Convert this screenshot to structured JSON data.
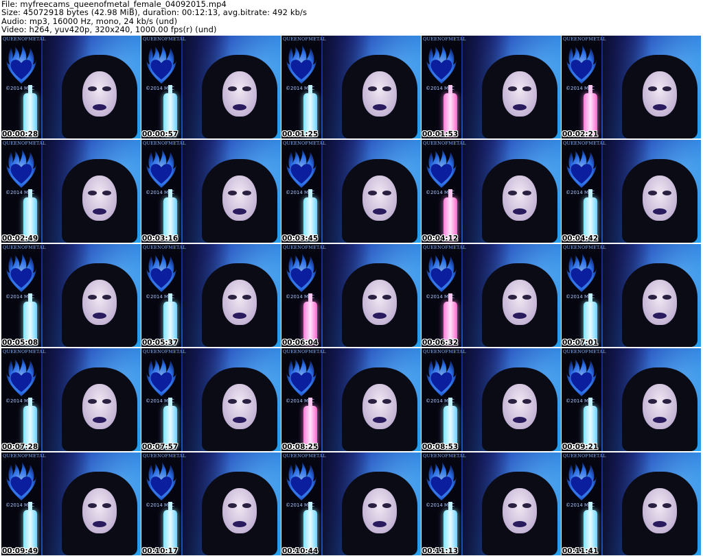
{
  "header": {
    "file_line": "File: myfreecams_queenofmetal_female_04092015.mp4",
    "size_line": "Size: 45072918 bytes (42.98 MiB), duration: 00:12:13, avg.bitrate: 492 kb/s",
    "audio_line": "Audio: mp3, 16000 Hz, mono, 24 kb/s (und)",
    "video_line": "Video: h264, yuv420p, 320x240, 1000.00 fps(r) (und)"
  },
  "overlay": {
    "logo_text": "QUEENOFMETAL",
    "copyright": "©2014 MFC"
  },
  "accent_colors": {
    "background_blue": "#1e74d8",
    "bottle_cyan": "#7be6ff",
    "bottle_pink": "#ff7ad9",
    "heart_flame": "#2f7bff"
  },
  "thumbnails": [
    {
      "timestamp": "00:00:28",
      "bottle": "cyan"
    },
    {
      "timestamp": "00:00:57",
      "bottle": "cyan"
    },
    {
      "timestamp": "00:01:25",
      "bottle": "cyan"
    },
    {
      "timestamp": "00:01:53",
      "bottle": "pink"
    },
    {
      "timestamp": "00:02:21",
      "bottle": "pink"
    },
    {
      "timestamp": "00:02:49",
      "bottle": "cyan"
    },
    {
      "timestamp": "00:03:16",
      "bottle": "cyan"
    },
    {
      "timestamp": "00:03:45",
      "bottle": "cyan"
    },
    {
      "timestamp": "00:04:12",
      "bottle": "pink"
    },
    {
      "timestamp": "00:04:42",
      "bottle": "cyan"
    },
    {
      "timestamp": "00:05:08",
      "bottle": "cyan"
    },
    {
      "timestamp": "00:05:37",
      "bottle": "cyan"
    },
    {
      "timestamp": "00:06:04",
      "bottle": "pink"
    },
    {
      "timestamp": "00:06:32",
      "bottle": "pink"
    },
    {
      "timestamp": "00:07:01",
      "bottle": "cyan"
    },
    {
      "timestamp": "00:07:28",
      "bottle": "cyan"
    },
    {
      "timestamp": "00:07:57",
      "bottle": "cyan"
    },
    {
      "timestamp": "00:08:25",
      "bottle": "pink"
    },
    {
      "timestamp": "00:08:53",
      "bottle": "cyan"
    },
    {
      "timestamp": "00:09:21",
      "bottle": "cyan"
    },
    {
      "timestamp": "00:09:49",
      "bottle": "cyan"
    },
    {
      "timestamp": "00:10:17",
      "bottle": "cyan"
    },
    {
      "timestamp": "00:10:44",
      "bottle": "cyan"
    },
    {
      "timestamp": "00:11:13",
      "bottle": "cyan"
    },
    {
      "timestamp": "00:11:41",
      "bottle": "cyan"
    }
  ]
}
